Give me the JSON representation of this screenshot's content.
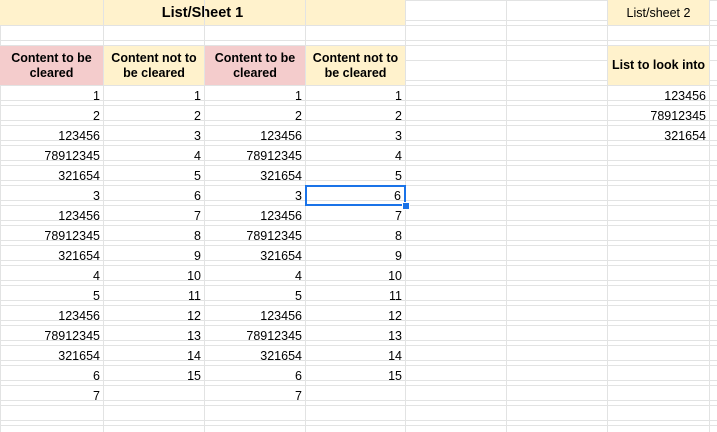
{
  "sheet1": {
    "title": "List/Sheet 1",
    "headers": [
      "Content to be cleared",
      "Content not to be cleared",
      "Content to be cleared",
      "Content not to be cleared"
    ],
    "columns": [
      [
        "1",
        "2",
        "123456",
        "78912345",
        "321654",
        "3",
        "123456",
        "78912345",
        "321654",
        "4",
        "5",
        "123456",
        "78912345",
        "321654",
        "6",
        "7"
      ],
      [
        "1",
        "2",
        "3",
        "4",
        "5",
        "6",
        "7",
        "8",
        "9",
        "10",
        "11",
        "12",
        "13",
        "14",
        "15",
        ""
      ],
      [
        "1",
        "2",
        "123456",
        "78912345",
        "321654",
        "3",
        "123456",
        "78912345",
        "321654",
        "4",
        "5",
        "123456",
        "78912345",
        "321654",
        "6",
        "7"
      ],
      [
        "1",
        "2",
        "3",
        "4",
        "5",
        "6",
        "7",
        "8",
        "9",
        "10",
        "11",
        "12",
        "13",
        "14",
        "15",
        ""
      ]
    ]
  },
  "sheet2": {
    "title": "List/sheet 2",
    "header": "List to look into",
    "values": [
      "123456",
      "78912345",
      "321654"
    ]
  },
  "colors": {
    "pink_header": "#f4cccc",
    "yellow_header": "#fff2cc",
    "selection": "#1a73e8",
    "gridline": "#e2e3e3"
  }
}
